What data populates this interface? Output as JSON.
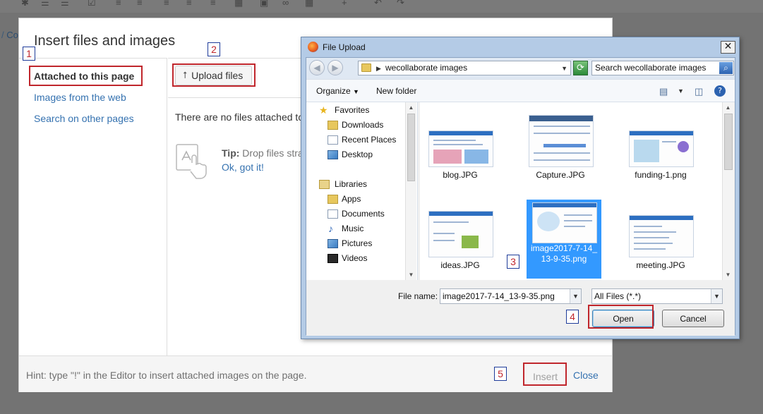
{
  "background": {
    "breadcrumb_sep": "/",
    "breadcrumb_link": "Co"
  },
  "insert_dialog": {
    "title": "Insert files and images",
    "sidebar": [
      {
        "label": "Attached to this page",
        "active": true
      },
      {
        "label": "Images from the web",
        "active": false
      },
      {
        "label": "Search on other pages",
        "active": false
      }
    ],
    "upload_button": "Upload files",
    "no_files_text": "There are no files attached to",
    "tip_label": "Tip:",
    "tip_text": "Drop files stra",
    "ok_link": "Ok, got it!",
    "hint": "Hint: type \"!\" in the Editor to insert attached images on the page.",
    "insert_button": "Insert",
    "close_link": "Close"
  },
  "markers": [
    "1",
    "2",
    "3",
    "4",
    "5"
  ],
  "file_upload": {
    "title": "File Upload",
    "address": "wecollaborate images",
    "search_placeholder": "Search wecollaborate images",
    "organize": "Organize",
    "new_folder": "New folder",
    "nav": [
      {
        "label": "Favorites",
        "icon": "star-icon"
      },
      {
        "label": "Downloads",
        "icon": "folder-icon"
      },
      {
        "label": "Recent Places",
        "icon": "recent-places-icon"
      },
      {
        "label": "Desktop",
        "icon": "desktop-icon"
      },
      {
        "label": "Libraries",
        "icon": "library-icon"
      },
      {
        "label": "Apps",
        "icon": "folder-icon"
      },
      {
        "label": "Documents",
        "icon": "documents-icon"
      },
      {
        "label": "Music",
        "icon": "music-icon"
      },
      {
        "label": "Pictures",
        "icon": "pictures-icon"
      },
      {
        "label": "Videos",
        "icon": "videos-icon"
      }
    ],
    "files": [
      {
        "name": "blog.JPG",
        "selected": false
      },
      {
        "name": "Capture.JPG",
        "selected": false
      },
      {
        "name": "funding-1.png",
        "selected": false
      },
      {
        "name": "ideas.JPG",
        "selected": false
      },
      {
        "name": "image2017-7-14_13-9-35.png",
        "name_line1": "image2017-7-14_",
        "name_line2": "13-9-35.png",
        "selected": true
      },
      {
        "name": "meeting.JPG",
        "selected": false
      }
    ],
    "file_name_label": "File name:",
    "file_name_value": "image2017-7-14_13-9-35.png",
    "file_type": "All Files (*.*)",
    "open_button": "Open",
    "cancel_button": "Cancel"
  },
  "colors": {
    "overlay": "#737373",
    "link": "#3572b0",
    "highlight_red": "#c0262c",
    "marker_border": "#1f3c9a",
    "selection_blue": "#3399ff"
  }
}
